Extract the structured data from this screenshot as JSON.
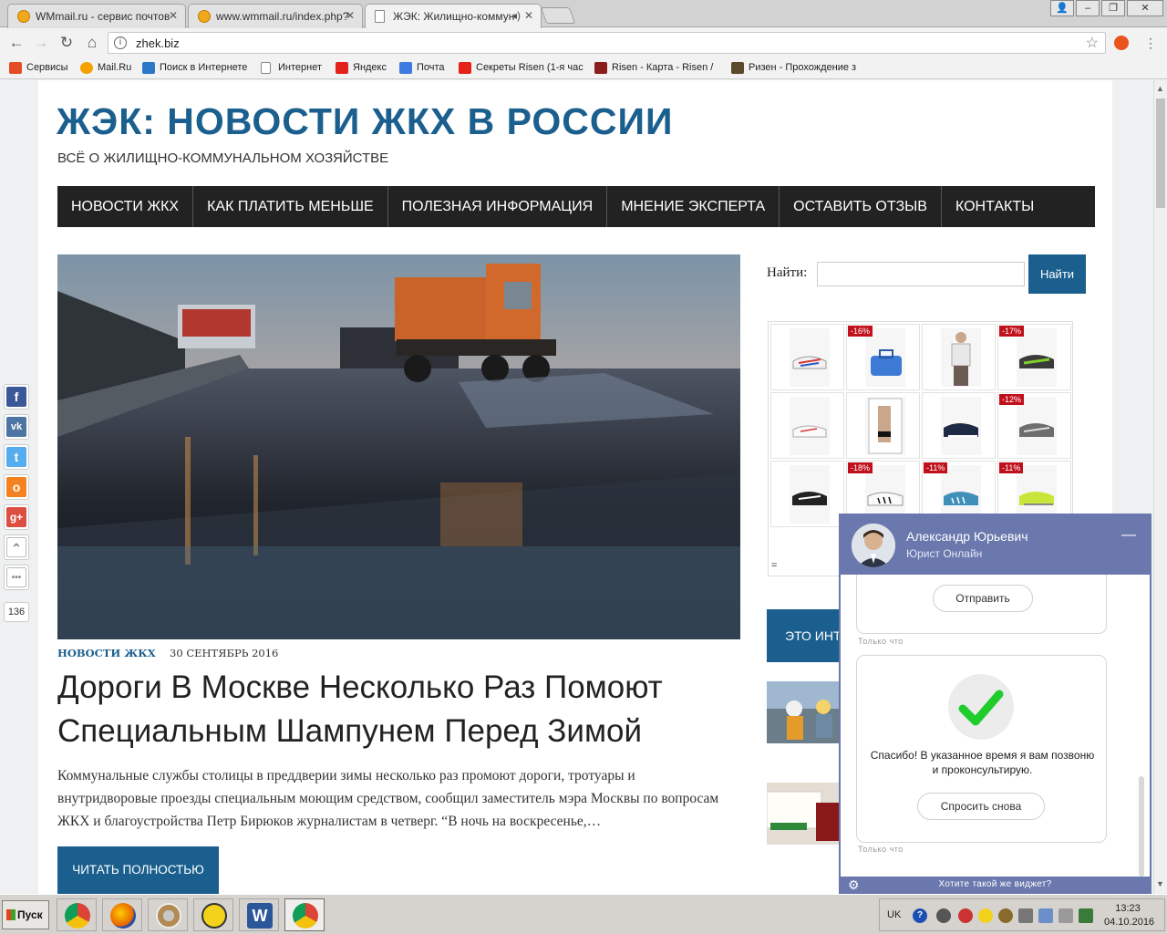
{
  "browser": {
    "tabs": [
      {
        "title": "WMmail.ru - сервис почтов",
        "icon": "wmmail-favicon"
      },
      {
        "title": "www.wmmail.ru/index.php?",
        "icon": "wmmail-favicon"
      },
      {
        "title": "ЖЭК: Жилищно-коммун",
        "icon": "document-favicon",
        "active": true
      }
    ],
    "url": "zhek.biz",
    "bookmarks": [
      {
        "label": "Сервисы",
        "color": "#e44d26"
      },
      {
        "label": "Mail.Ru",
        "color": "#f5a100"
      },
      {
        "label": "Поиск в Интернете",
        "color": "#2d77c9"
      },
      {
        "label": "Интернет",
        "color": "#ffffff"
      },
      {
        "label": "Яндекс",
        "color": "#e3231b"
      },
      {
        "label": "Почта",
        "color": "#3d7be0"
      },
      {
        "label": "Секреты Risen (1-я час",
        "color": "#e62117"
      },
      {
        "label": "Risen - Карта - Risen /",
        "color": "#8b1d1d"
      },
      {
        "label": "Ризен - Прохождение з",
        "color": "#5a4a2a"
      }
    ]
  },
  "site": {
    "title": "ЖЭК: НОВОСТИ ЖКХ В РОССИИ",
    "description": "ВСЁ О ЖИЛИЩНО-КОММУНАЛЬНОМ ХОЗЯЙСТВЕ",
    "accent_color": "#1b5f8e",
    "nav": [
      "НОВОСТИ ЖКХ",
      "КАК ПЛАТИТЬ МЕНЬШЕ",
      "ПОЛЕЗНАЯ ИНФОРМАЦИЯ",
      "МНЕНИЕ ЭКСПЕРТА",
      "ОСТАВИТЬ ОТЗЫВ",
      "КОНТАКТЫ"
    ]
  },
  "post": {
    "category": "НОВОСТИ ЖКХ",
    "date": "30 СЕНТЯБРЬ 2016",
    "title": "Дороги В Москве Несколько Раз Помоют Специальным Шампунем Перед Зимой",
    "excerpt": "Коммунальные службы столицы в преддверии зимы несколько раз промоют дороги, тротуары и внутридворовые проезды специальным моющим средством, сообщил заместитель мэра Москвы по вопросам ЖКХ и благоустройства Петр Бирюков журналистам в четверг. “В ночь на воскресенье,…",
    "read_more": "ЧИТАТЬ ПОЛНОСТЬЮ"
  },
  "sidebar": {
    "search_label": "Найти:",
    "search_value": "",
    "search_button": "Найти",
    "shop_discounts": [
      "",
      "-16%",
      "",
      "-17%",
      "",
      "",
      "",
      "-12%",
      "",
      "-18%",
      "-11%",
      "-11%"
    ],
    "shop_footer": "=",
    "promo_label": "ЭТО ИНТ"
  },
  "share": {
    "icons": [
      "facebook-icon",
      "vk-icon",
      "twitter-icon",
      "odnoklassniki-icon",
      "google-plus-icon",
      "scroll-up-icon",
      "more-icon"
    ],
    "count": "136"
  },
  "chat": {
    "name": "Александр Юрьевич",
    "role": "Юрист Онлайн",
    "send_button": "Отправить",
    "timestamp1": "Только что",
    "thanks": "Спасибо! В указанное время я вам позвоню и проконсультирую.",
    "ask_again": "Спросить снова",
    "timestamp2": "Только что",
    "footer_cta": "Хотите такой же виджет?",
    "header_color": "#6a78ad"
  },
  "taskbar": {
    "start": "Пуск",
    "apps": [
      "chrome-icon",
      "firefox-icon",
      "paint-icon",
      "ghost-icon",
      "word-icon",
      "chrome-icon"
    ],
    "lang": "UK",
    "time": "13:23",
    "date": "04.10.2016"
  }
}
